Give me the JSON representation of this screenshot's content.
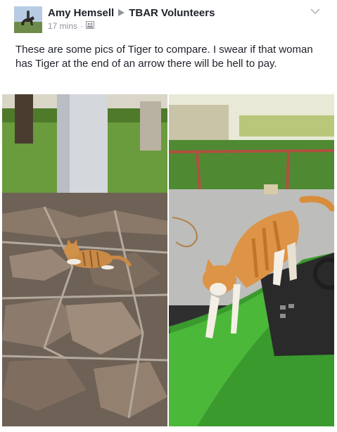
{
  "post": {
    "author": "Amy Hemsell",
    "group": "TBAR Volunteers",
    "time": "17 mins",
    "separator": "·",
    "text": "These are some pics of Tiger to compare. I swear if that woman has Tiger at the end of an arrow there will be hell to pay."
  },
  "icons": {
    "share_arrow": "right-triangle-icon",
    "audience": "group-audience-icon",
    "menu": "chevron-down-icon"
  },
  "colors": {
    "text": "#1d2129",
    "meta": "#90949c",
    "link": "#1d2129"
  }
}
